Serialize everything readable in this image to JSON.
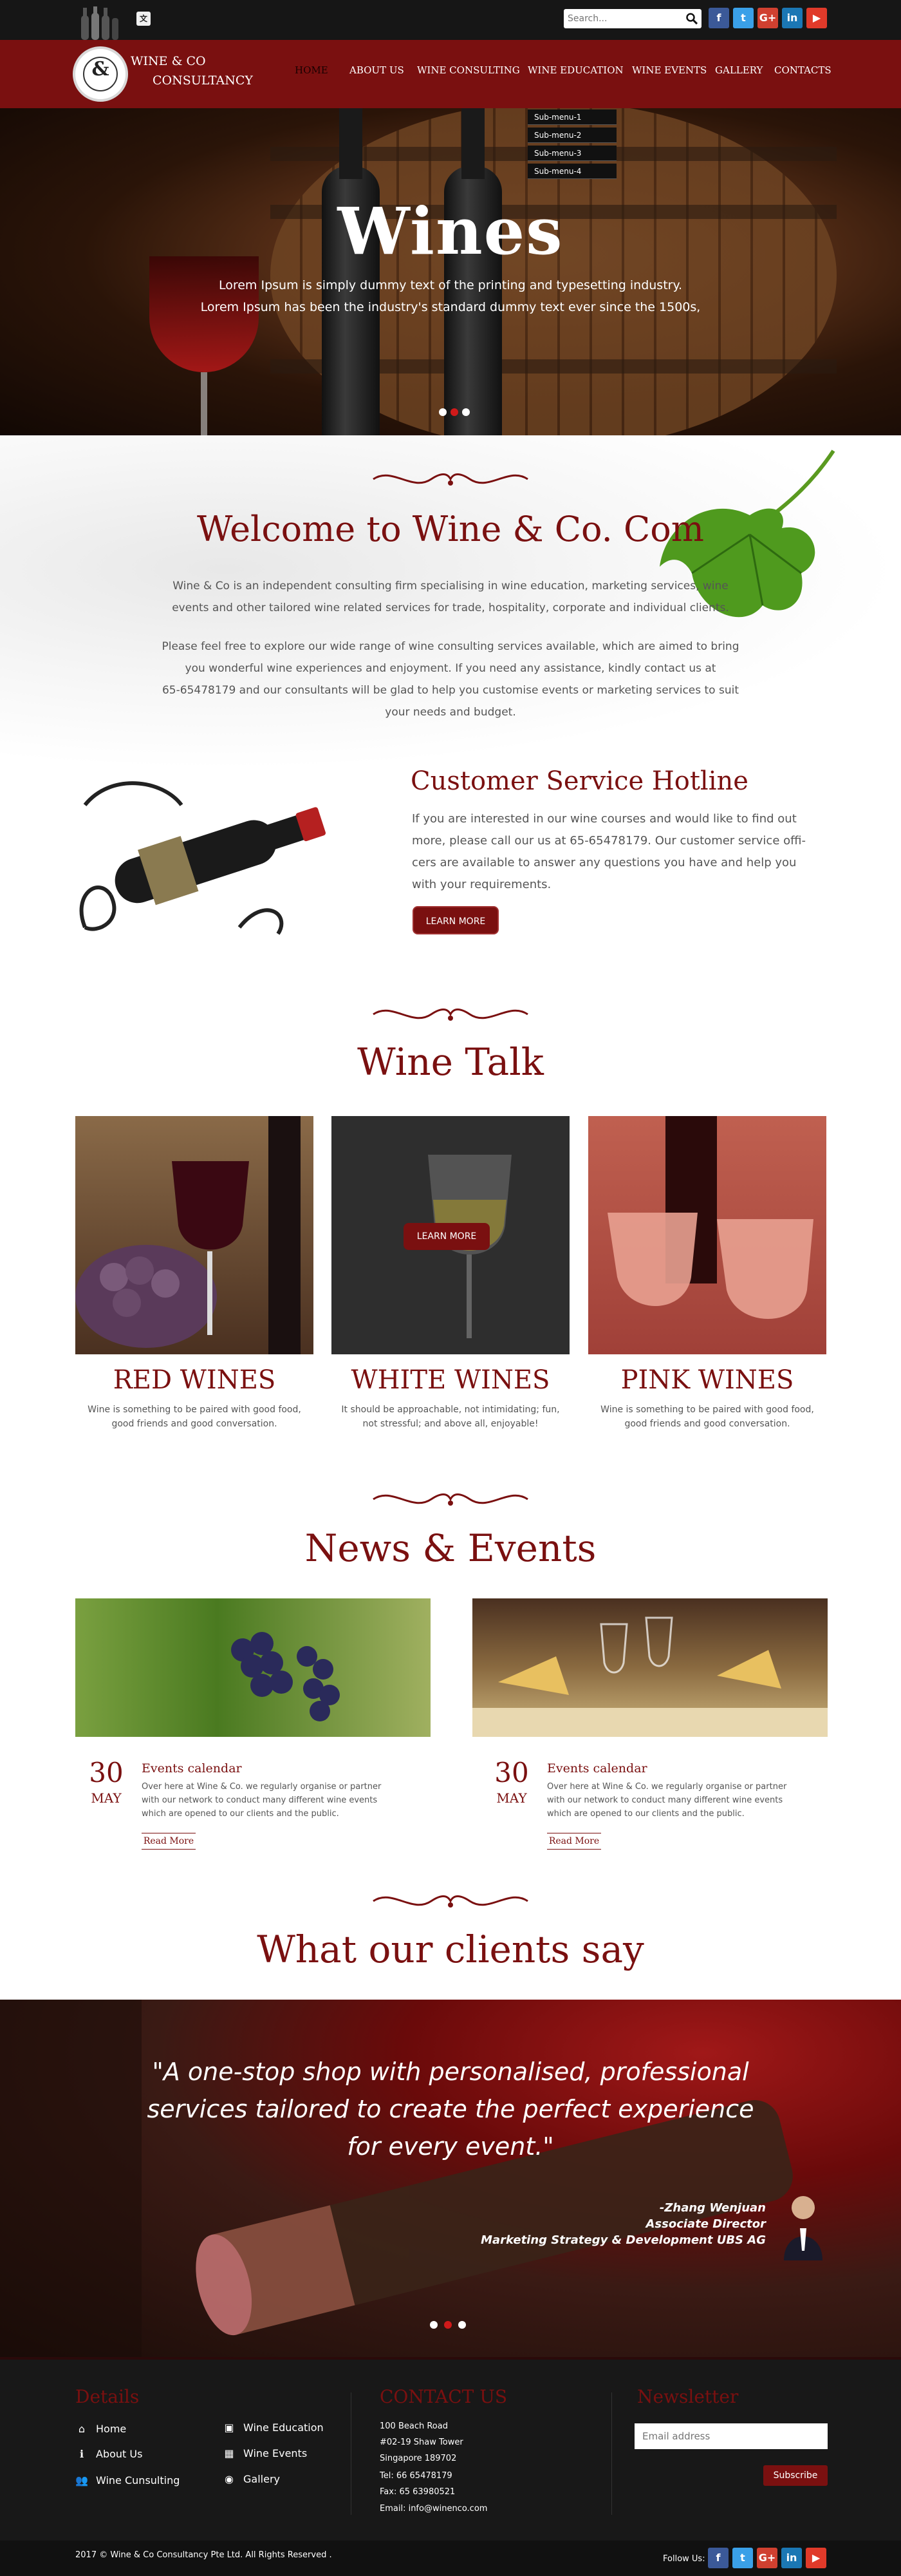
{
  "top_bar": {
    "search": {
      "placeholder": "Search..."
    },
    "social": [
      {
        "name": "facebook-icon",
        "glyph": "f",
        "color": "#3b5998"
      },
      {
        "name": "twitter-icon",
        "glyph": "t",
        "color": "#3aa0e8"
      },
      {
        "name": "google-plus-icon",
        "glyph": "G+",
        "color": "#d04030"
      },
      {
        "name": "linkedin-icon",
        "glyph": "in",
        "color": "#1b77b4"
      },
      {
        "name": "youtube-icon",
        "glyph": "▶",
        "color": "#e03a2a"
      }
    ]
  },
  "brand": {
    "line1": "WINE & CO",
    "line2": "CONSULTANCY",
    "logo_glyph": "&"
  },
  "nav": {
    "items": [
      "HOME",
      "ABOUT US",
      "WINE CONSULTING",
      "WINE EDUCATION",
      "WINE EVENTS",
      "GALLERY",
      "CONTACTS"
    ],
    "submenu": [
      "Sub-menu-1",
      "Sub-menu-2",
      "Sub-menu-3",
      "Sub-menu-4"
    ]
  },
  "hero": {
    "title": "Wines",
    "sub1": "Lorem Ipsum is simply dummy text of the printing and typesetting industry.",
    "sub2": "Lorem Ipsum has been the industry's standard dummy text ever since the 1500s,"
  },
  "welcome": {
    "title": "Welcome to Wine & Co. Com",
    "para1_line1": "Wine & Co is an independent consulting firm specialising in wine education, marketing services, wine",
    "para1_line2": "events and other tailored wine related services for trade, hospitality, corporate and individual clients.",
    "para2_line1": "Please feel free to explore our wide range of wine consulting services available, which are aimed to bring",
    "para2_line2": "you wonderful wine experiences and enjoyment. If you need any assistance, kindly contact us at",
    "para2_line3": "65-65478179 and our consultants will be glad to help you customise events or marketing services to suit",
    "para2_line4": "your needs and budget."
  },
  "hotline": {
    "title_light": "Customer",
    "title_bold": "Service Hotline",
    "line1": "If you are interested in our wine courses and would like to find out",
    "line2": "more, please call our us at 65-65478179. Our customer service offi-",
    "line3": "cers are available to answer any questions you have and help you",
    "line4": "with your requirements.",
    "button": "LEARN MORE"
  },
  "wine_talk": {
    "title": "Wine Talk",
    "overlay_button": "LEARN MORE",
    "cards": [
      {
        "title": "RED WINES",
        "desc1": "Wine is something to be paired with good food,",
        "desc2": "good friends and good conversation."
      },
      {
        "title": "WHITE WINES",
        "desc1": "It should be approachable, not intimidating; fun,",
        "desc2": "not stressful; and above all, enjoyable!"
      },
      {
        "title": "PINK WINES",
        "desc1": "Wine is something to be paired with good food,",
        "desc2": "good friends and good conversation."
      }
    ]
  },
  "news": {
    "title": "News & Events",
    "items": [
      {
        "day": "30",
        "month": "MAY",
        "heading": "Events  calendar",
        "line1": "Over here at Wine & Co. we regularly organise or partner",
        "line2": "with our network to conduct many different wine events",
        "line3": "which are opened to our clients and the public.",
        "read_more": "Read More"
      },
      {
        "day": "30",
        "month": "MAY",
        "heading": "Events  calendar",
        "line1": "Over here at Wine & Co. we regularly organise or partner",
        "line2": "with our network to conduct many different wine events",
        "line3": "which are opened to our clients and the public.",
        "read_more": "Read More"
      }
    ]
  },
  "testimonial": {
    "title": "What our clients say",
    "quote1": "\"A one-stop shop with personalised, professional",
    "quote2": "services tailored to create the perfect experience",
    "quote3": "for every event.\"",
    "author": "-Zhang Wenjuan",
    "role": "Associate Director",
    "company": "Marketing Strategy & Development UBS AG"
  },
  "footer": {
    "details_title": "Details",
    "links_col1": [
      {
        "icon": "home-icon",
        "glyph": "⌂",
        "label": "Home"
      },
      {
        "icon": "info-icon",
        "glyph": "ℹ",
        "label": "About Us"
      },
      {
        "icon": "users-icon",
        "glyph": "👥",
        "label": "Wine Cunsulting"
      }
    ],
    "links_col2": [
      {
        "icon": "briefcase-icon",
        "glyph": "▣",
        "label": "Wine Education"
      },
      {
        "icon": "calendar-icon",
        "glyph": "▦",
        "label": "Wine Events"
      },
      {
        "icon": "camera-icon",
        "glyph": "◉",
        "label": "Gallery"
      }
    ],
    "contact_title": "CONTACT US",
    "address": [
      "100 Beach Road",
      "#02-19 Shaw Tower",
      "Singapore 189702",
      "Tel: 66 65478179",
      "Fax: 65 63980521",
      "Email: info@winenco.com"
    ],
    "newsletter_title": "Newsletter",
    "email_placeholder": "Email address",
    "subscribe": "Subscribe",
    "copyright": "2017 © Wine & Co Consultancy Pte Ltd. All Rights Reserved .",
    "follow": "Follow Us:"
  },
  "colors": {
    "brand": "#7a1010",
    "topbar": "#161616",
    "footer": "#181818"
  }
}
